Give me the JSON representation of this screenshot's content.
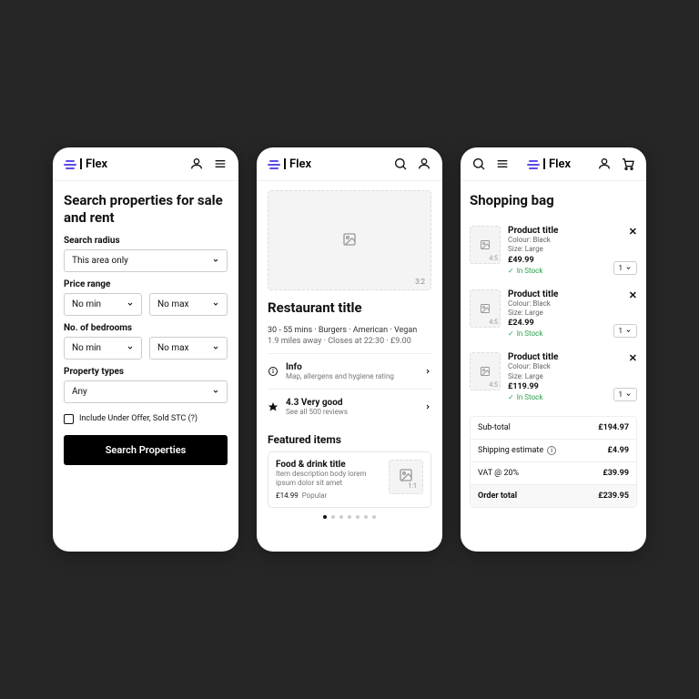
{
  "brand": "Flex",
  "p1": {
    "title": "Search properties for sale and rent",
    "radius_label": "Search radius",
    "radius_value": "This area only",
    "price_label": "Price range",
    "min": "No min",
    "max": "No max",
    "beds_label": "No. of bedrooms",
    "types_label": "Property types",
    "types_value": "Any",
    "include_label": "Include Under Offer, Sold STC (?)",
    "cta": "Search Properties"
  },
  "p2": {
    "hero_ratio": "3:2",
    "title": "Restaurant title",
    "meta1": "30 - 55 mins · Burgers · American · Vegan",
    "meta2": "1.9 miles away · Closes at 22:30 · £9.00",
    "info_title": "Info",
    "info_sub": "Map, allergens and hygiene rating",
    "rating_title": "4.3 Very good",
    "rating_sub": "See all 500 reviews",
    "featured": "Featured items",
    "item_title": "Food & drink title",
    "item_desc": "Item description body lorem ipsum dolor sit amet",
    "item_price": "£14.99",
    "item_tag": "Popular",
    "item_ratio": "1:1"
  },
  "p3": {
    "title": "Shopping bag",
    "items": [
      {
        "title": "Product title",
        "colour": "Colour: Black",
        "size": "Size: Large",
        "price": "£49.99",
        "stock": "In Stock",
        "qty": "1",
        "ratio": "4:5"
      },
      {
        "title": "Product title",
        "colour": "Colour: Black",
        "size": "Size: Large",
        "price": "£24.99",
        "stock": "In Stock",
        "qty": "1",
        "ratio": "4:5"
      },
      {
        "title": "Product title",
        "colour": "Colour: Black",
        "size": "Size: Large",
        "price": "£119.99",
        "stock": "In Stock",
        "qty": "1",
        "ratio": "4:5"
      }
    ],
    "subtotal_l": "Sub-total",
    "subtotal_v": "£194.97",
    "ship_l": "Shipping estimate",
    "ship_v": "£4.99",
    "vat_l": "VAT @ 20%",
    "vat_v": "£39.99",
    "total_l": "Order total",
    "total_v": "£239.95"
  }
}
